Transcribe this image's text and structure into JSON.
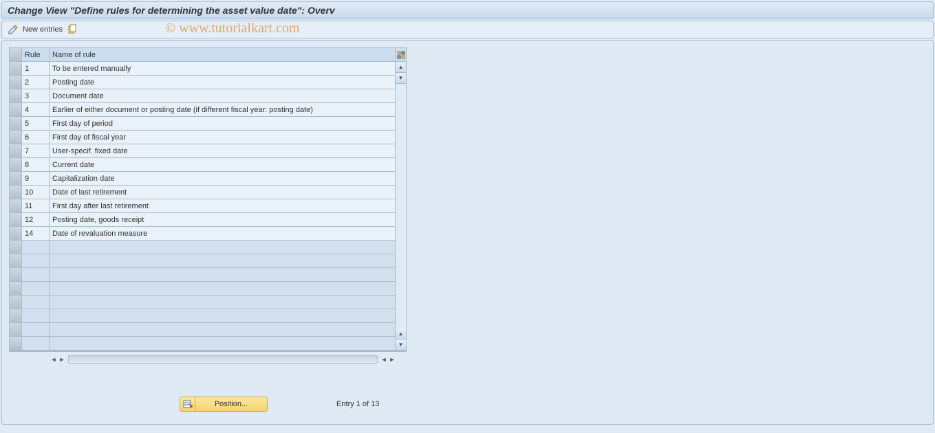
{
  "title": "Change View \"Define rules for determining the asset value date\": Overv",
  "toolbar": {
    "new_entries_label": "New entries"
  },
  "watermark": "© www.tutorialkart.com",
  "table": {
    "columns": {
      "rule": "Rule",
      "name": "Name of rule"
    },
    "rows": [
      {
        "rule": "1",
        "name": "To be entered manually"
      },
      {
        "rule": "2",
        "name": "Posting date"
      },
      {
        "rule": "3",
        "name": "Document date"
      },
      {
        "rule": "4",
        "name": "Earlier of either document or posting date (if different fiscal year: posting date)"
      },
      {
        "rule": "5",
        "name": "First day of period"
      },
      {
        "rule": "6",
        "name": "First day of fiscal year"
      },
      {
        "rule": "7",
        "name": "User-specif. fixed date"
      },
      {
        "rule": "8",
        "name": "Current date"
      },
      {
        "rule": "9",
        "name": "Capitalization date"
      },
      {
        "rule": "10",
        "name": "Date of last retirement"
      },
      {
        "rule": "11",
        "name": "First day after last retirement"
      },
      {
        "rule": "12",
        "name": "Posting date, goods receipt"
      },
      {
        "rule": "14",
        "name": "Date of revaluation measure"
      }
    ],
    "empty_rows": 8
  },
  "footer": {
    "position_label": "Position...",
    "entry_text": "Entry 1 of 13"
  }
}
